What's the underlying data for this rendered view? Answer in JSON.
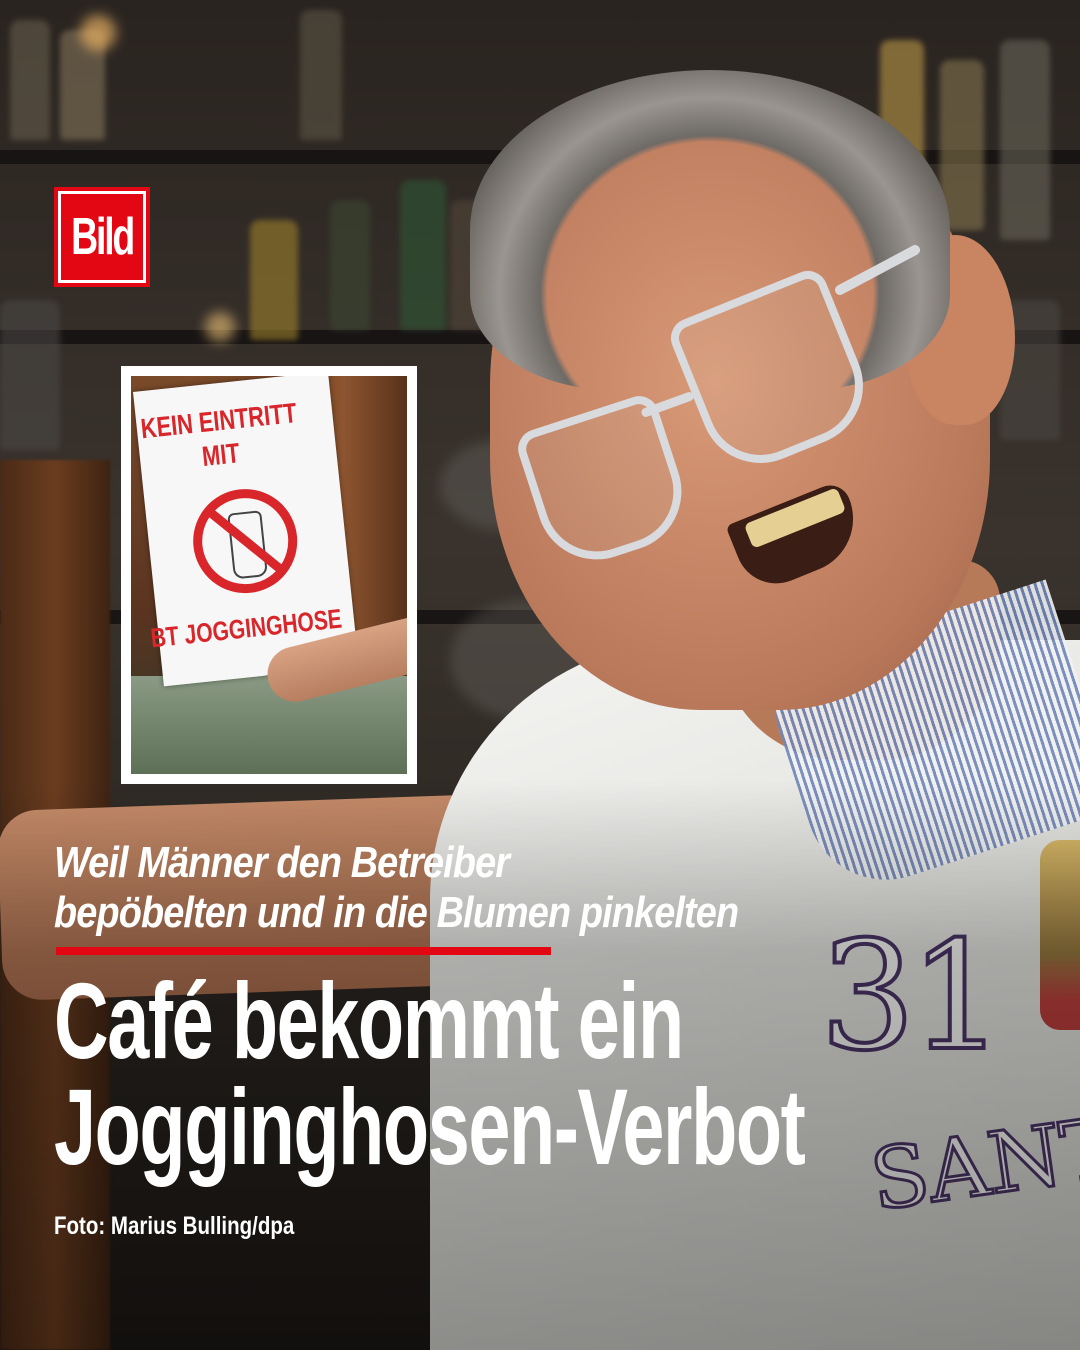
{
  "brand": {
    "logo_text": "Bild",
    "accent_color": "#e30613"
  },
  "inset_photo": {
    "poster_lines": [
      "KEIN EINTRITT",
      "MIT",
      "BT   JOGGINGHOSE"
    ],
    "symbol": "no-sweatpants-icon"
  },
  "article": {
    "kicker_line1": "Weil Männer den Betreiber",
    "kicker_line2": "bepöbelten und in die Blumen pinkelten",
    "headline_line1": "Café bekommt ein",
    "headline_line2": "Jogginghosen-Verbot",
    "photo_credit": "Foto: Marius Bulling/dpa"
  }
}
